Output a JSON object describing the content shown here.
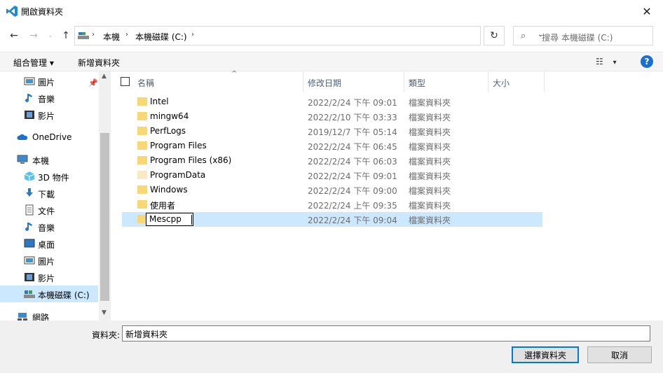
{
  "window": {
    "title": "開啟資料夾",
    "close_label": "✕"
  },
  "address": {
    "segments": [
      "本機",
      "本機磁碟 (C:)"
    ],
    "search_placeholder": "搜尋 本機磁碟 (C:)"
  },
  "commands": {
    "organize": "組合管理 ▾",
    "new_folder": "新增資料夾"
  },
  "nav_pane": {
    "items": [
      {
        "label": "圖片",
        "icon": "pictures-icon"
      },
      {
        "label": "音樂",
        "icon": "music-icon"
      },
      {
        "label": "影片",
        "icon": "videos-icon"
      },
      {
        "label": "OneDrive",
        "icon": "onedrive-icon"
      },
      {
        "label": "本機",
        "icon": "this-pc-icon"
      },
      {
        "label": "3D 物件",
        "icon": "3d-objects-icon"
      },
      {
        "label": "下載",
        "icon": "downloads-icon"
      },
      {
        "label": "文件",
        "icon": "documents-icon"
      },
      {
        "label": "音樂",
        "icon": "music-icon"
      },
      {
        "label": "桌面",
        "icon": "desktop-icon"
      },
      {
        "label": "圖片",
        "icon": "pictures-icon"
      },
      {
        "label": "影片",
        "icon": "videos-icon"
      },
      {
        "label": "本機磁碟 (C:)",
        "icon": "drive-icon"
      },
      {
        "label": "網路",
        "icon": "network-icon"
      }
    ]
  },
  "columns": {
    "name": "名稱",
    "date": "修改日期",
    "type": "類型",
    "size": "大小"
  },
  "files": [
    {
      "name": "Intel",
      "date": "2022/2/24 下午 09:01",
      "type": "檔案資料夾"
    },
    {
      "name": "mingw64",
      "date": "2022/2/10 下午 03:33",
      "type": "檔案資料夾"
    },
    {
      "name": "PerfLogs",
      "date": "2019/12/7 下午 05:14",
      "type": "檔案資料夾"
    },
    {
      "name": "Program Files",
      "date": "2022/2/24 下午 06:45",
      "type": "檔案資料夾"
    },
    {
      "name": "Program Files (x86)",
      "date": "2022/2/24 下午 06:03",
      "type": "檔案資料夾"
    },
    {
      "name": "ProgramData",
      "date": "2022/2/24 下午 09:01",
      "type": "檔案資料夾"
    },
    {
      "name": "Windows",
      "date": "2022/2/24 下午 09:00",
      "type": "檔案資料夾"
    },
    {
      "name": "使用者",
      "date": "2022/2/24 上午 09:35",
      "type": "檔案資料夾"
    },
    {
      "name": "Mescpp",
      "date": "2022/2/24 下午 09:04",
      "type": "檔案資料夾"
    }
  ],
  "footer": {
    "folder_label": "資料夾:",
    "folder_value": "新增資料夾",
    "select_button": "選擇資料夾",
    "cancel_button": "取消"
  },
  "colors": {
    "selection": "#cce8ff",
    "accent": "#0078d7",
    "folder": "#f8d775"
  }
}
